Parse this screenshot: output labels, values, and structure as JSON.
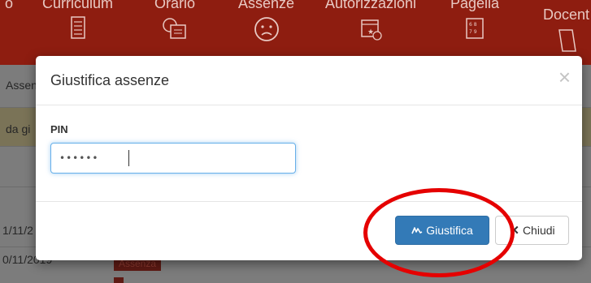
{
  "navbar": {
    "items": [
      {
        "label": "o",
        "icon": ""
      },
      {
        "label": "Curriculum",
        "icon": "document-icon"
      },
      {
        "label": "Orario",
        "icon": "calendar-clock-icon"
      },
      {
        "label": "Assenze",
        "icon": "sad-face-icon"
      },
      {
        "label": "Autorizzazioni",
        "icon": "calendar-star-icon"
      },
      {
        "label": "Pagella",
        "icon": "report-card-icon"
      },
      {
        "label": "Docent",
        "icon": "book-icon"
      }
    ]
  },
  "background": {
    "col_header": "Assen",
    "notice": "da gi",
    "dates": [
      "1/11/2",
      "0/11/2019"
    ],
    "tag": "Assenza"
  },
  "modal": {
    "title": "Giustifica assenze",
    "close_label": "×",
    "pin_label": "PIN",
    "pin_value": "••••••",
    "justify_label": "Giustifica",
    "close_button_label": "Chiudi"
  },
  "colors": {
    "navbar": "#8e1d10",
    "primary": "#337ab7",
    "annotation": "#e50000"
  }
}
